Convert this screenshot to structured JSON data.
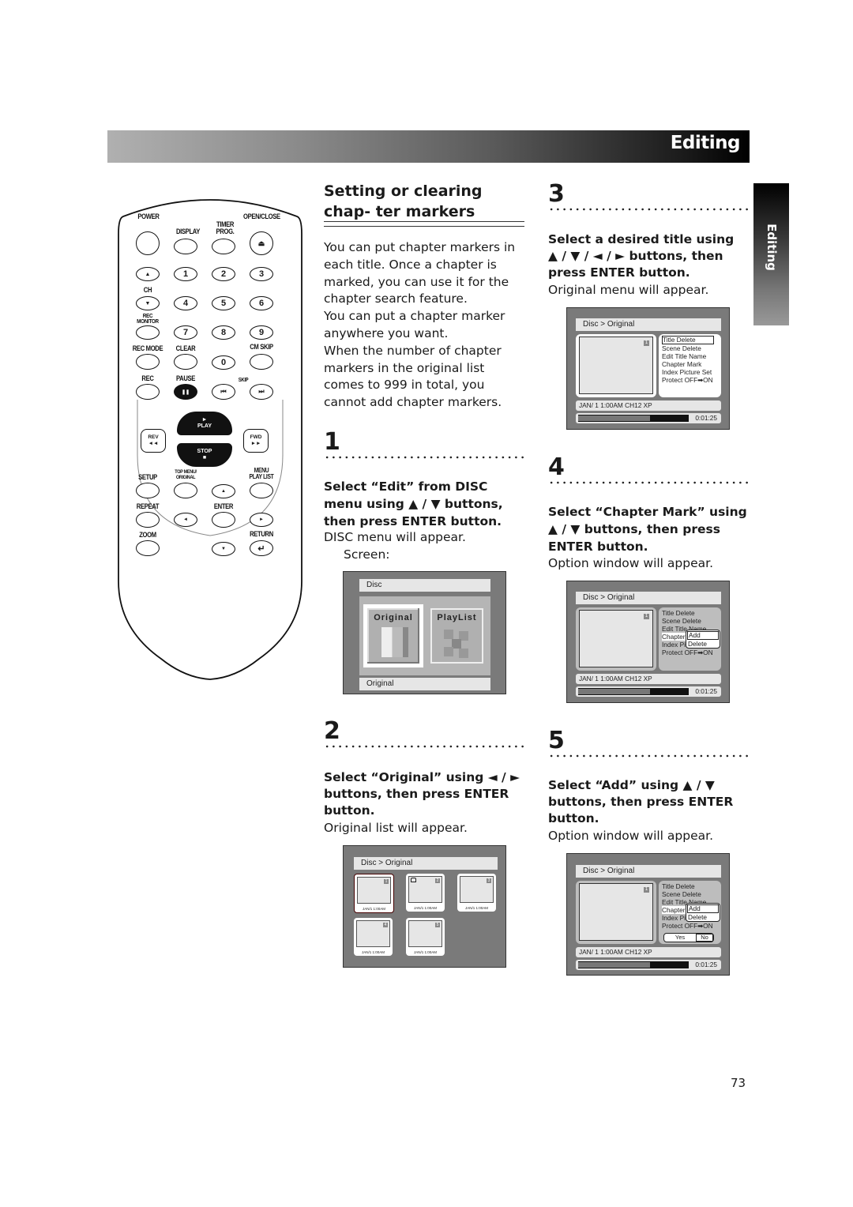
{
  "header": {
    "title": "Editing"
  },
  "side_tab": {
    "label": "Editing"
  },
  "remote": {
    "labels": {
      "power": "POWER",
      "display": "DISPLAY",
      "timer_prog": "TIMER\nPROG.",
      "open_close": "OPEN/CLOSE",
      "ch": "CH",
      "rec_monitor": "REC\nMONITOR",
      "rec_mode": "REC MODE",
      "clear": "CLEAR",
      "cm_skip": "CM SKIP",
      "rec": "REC",
      "pause": "PAUSE",
      "skip": "SKIP",
      "play": "PLAY",
      "stop": "STOP",
      "rev": "REV",
      "fwd": "FWD",
      "setup": "SETUP",
      "top_menu": "TOP MENU/\nORIGINAL",
      "menu": "MENU\nPLAY LIST",
      "repeat": "REPEAT",
      "enter": "ENTER",
      "zoom": "ZOOM",
      "return": "RETURN"
    },
    "digits": [
      "1",
      "2",
      "3",
      "4",
      "5",
      "6",
      "7",
      "8",
      "9",
      "0"
    ],
    "glyphs": {
      "eject": "⏏",
      "up": "▲",
      "down": "▼",
      "left": "◄",
      "right": "►",
      "pause": "❚❚",
      "skip_back": "⏮",
      "skip_fwd": "⏭",
      "play": "►",
      "stop": "■",
      "rev": "◄◄",
      "fwd": "►►",
      "return": "↵"
    }
  },
  "section": {
    "title": "Setting or clearing chap- ter markers",
    "intro": [
      "You can put chapter markers in each title. Once a chapter is marked, you can use it for the chapter search feature.",
      "You can put a chapter marker anywhere you want.",
      "When the number of chapter markers in the original list comes to 999 in total, you cannot add chapter markers."
    ]
  },
  "steps": [
    {
      "number": "1",
      "instruction": "Select “Edit” from DISC menu using ▲ / ▼ buttons, then press ENTER button.",
      "result": "DISC menu will appear.",
      "note": "Screen:"
    },
    {
      "number": "2",
      "instruction": "Select “Original” using ◄ / ► buttons, then press ENTER button.",
      "result": "Original list will appear."
    },
    {
      "number": "3",
      "instruction": "Select a desired title using ▲ / ▼ / ◄ / ► buttons, then press ENTER button.",
      "result": "Original menu will appear."
    },
    {
      "number": "4",
      "instruction": "Select “Chapter Mark” using ▲ / ▼ buttons, then press ENTER button.",
      "result": "Option window will appear."
    },
    {
      "number": "5",
      "instruction": "Select “Add” using ▲ / ▼ buttons, then press ENTER button.",
      "result": "Option window will appear."
    }
  ],
  "screens": {
    "disc_menu": {
      "title": "Disc",
      "options": [
        "Original",
        "PlayList"
      ],
      "selected": "Original",
      "footer": "Original"
    },
    "original_list": {
      "breadcrumb": "Disc > Original",
      "thumbs": [
        {
          "num": "1",
          "date": "JAN/1   1:00AM",
          "selected": true
        },
        {
          "num": "2",
          "date": "JAN/1   1:00AM",
          "locked": true
        },
        {
          "num": "3",
          "date": "JAN/1   1:00AM"
        },
        {
          "num": "4",
          "date": "JAN/1   1:00AM"
        },
        {
          "num": "5",
          "date": "JAN/1   1:00AM"
        }
      ]
    },
    "original_menu": {
      "breadcrumb": "Disc > Original",
      "title_num": "1",
      "menu": [
        "Title Delete",
        "Scene Delete",
        "Edit Title Name",
        "Chapter Mark",
        "Index Picture Set",
        "Protect OFF➡ON"
      ],
      "info": "JAN/ 1   1:00AM  CH12     XP",
      "time": "0:01:25",
      "progress": 0.65
    },
    "popup": {
      "options": [
        "Add",
        "Delete"
      ],
      "selected": "Add"
    },
    "confirm": {
      "yes": "Yes",
      "no": "No",
      "selected": "No"
    }
  },
  "page_number": "73"
}
